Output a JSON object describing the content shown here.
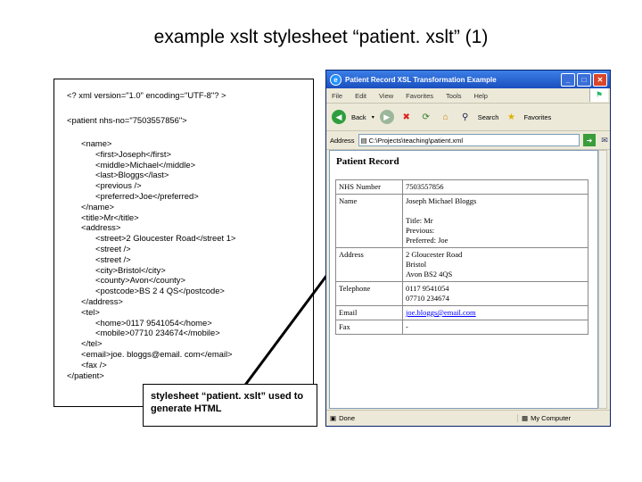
{
  "slide": {
    "title": "example xslt stylesheet “patient. xslt” (1)",
    "caption": "stylesheet “patient. xslt” used to generate HTML"
  },
  "xml_lines": [
    {
      "indent": 0,
      "text": "<? xml version=\"1.0\" encoding=\"UTF-8\"? >"
    },
    {
      "indent": 0,
      "text": "<patient nhs-no=\"7503557856\">"
    },
    {
      "indent": 1,
      "text": "<name>"
    },
    {
      "indent": 2,
      "text": "<first>Joseph</first>"
    },
    {
      "indent": 2,
      "text": "<middle>Michael</middle>"
    },
    {
      "indent": 2,
      "text": "<last>Bloggs</last>"
    },
    {
      "indent": 2,
      "text": "<previous />"
    },
    {
      "indent": 2,
      "text": "<preferred>Joe</preferred>"
    },
    {
      "indent": 1,
      "text": "</name>"
    },
    {
      "indent": 1,
      "text": "<title>Mr</title>"
    },
    {
      "indent": 1,
      "text": "<address>"
    },
    {
      "indent": 2,
      "text": "<street>2 Gloucester Road</street 1>"
    },
    {
      "indent": 2,
      "text": "<street />"
    },
    {
      "indent": 2,
      "text": "<street />"
    },
    {
      "indent": 2,
      "text": "<city>Bristol</city>"
    },
    {
      "indent": 2,
      "text": "<county>Avon</county>"
    },
    {
      "indent": 2,
      "text": "<postcode>BS 2 4 QS</postcode>"
    },
    {
      "indent": 1,
      "text": "</address>"
    },
    {
      "indent": 1,
      "text": "<tel>"
    },
    {
      "indent": 2,
      "text": "<home>0117 9541054</home>"
    },
    {
      "indent": 2,
      "text": "<mobile>07710 234674</mobile>"
    },
    {
      "indent": 1,
      "text": "</tel>"
    },
    {
      "indent": 1,
      "text": "<email>joe. bloggs@email. com</email>"
    },
    {
      "indent": 1,
      "text": "<fax />"
    },
    {
      "indent": 0,
      "text": "</patient>"
    }
  ],
  "browser": {
    "window_title": "Patient Record XSL Transformation Example",
    "menu": [
      "File",
      "Edit",
      "View",
      "Favorites",
      "Tools",
      "Help"
    ],
    "toolbar": {
      "back": "Back",
      "search": "Search",
      "favorites": "Favorites"
    },
    "address_label": "Address",
    "address_value": "C:\\Projects\\teaching\\patient.xml",
    "page_heading": "Patient Record",
    "rows": [
      {
        "label": "NHS Number",
        "lines": [
          "7503557856"
        ]
      },
      {
        "label": "Name",
        "lines": [
          "Joseph Michael Bloggs",
          "",
          "Title: Mr",
          "Previous:",
          "Preferred: Joe"
        ]
      },
      {
        "label": "Address",
        "lines": [
          "2 Gloucester Road",
          "Bristol",
          "Avon BS2 4QS"
        ]
      },
      {
        "label": "Telephone",
        "lines": [
          "0117 9541054",
          "07710 234674"
        ]
      },
      {
        "label": "Email",
        "lines": [
          "joe.bloggs@email.com"
        ],
        "link": true
      },
      {
        "label": "Fax",
        "lines": [
          "-"
        ]
      }
    ],
    "status_left": "Done",
    "status_right": "My Computer"
  },
  "colors": {
    "titlebar": "#1a4fbf",
    "link": "#0000ff"
  }
}
